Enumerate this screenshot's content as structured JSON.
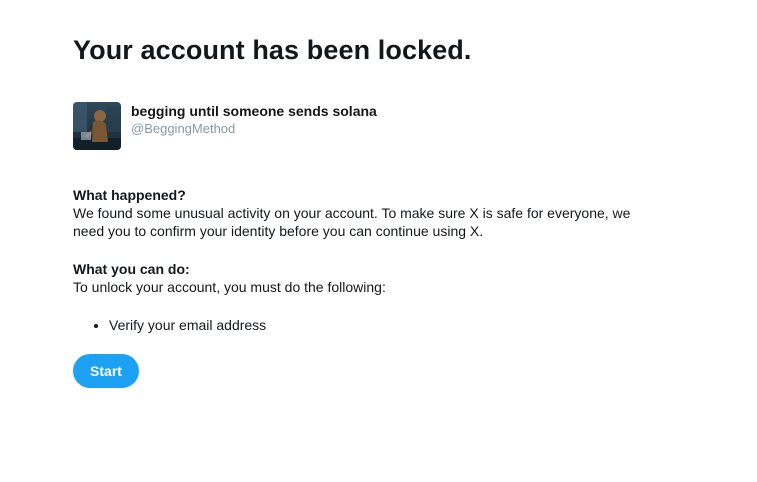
{
  "heading": "Your account has been locked.",
  "account": {
    "display_name": "begging until someone sends solana",
    "handle": "@BeggingMethod",
    "avatar_icon": "profile-photo"
  },
  "what_happened": {
    "heading": "What happened?",
    "body": "We found some unusual activity on your account. To make sure X is safe for everyone, we need you to confirm your identity before you can continue using X."
  },
  "what_you_can_do": {
    "heading": "What you can do:",
    "body": "To unlock your account, you must do the following:",
    "steps": [
      "Verify your email address"
    ]
  },
  "start_button": {
    "label": "Start",
    "color": "#1da1f2"
  },
  "colors": {
    "text": "#14171a",
    "handle": "#8899a6",
    "accent": "#1da1f2"
  }
}
